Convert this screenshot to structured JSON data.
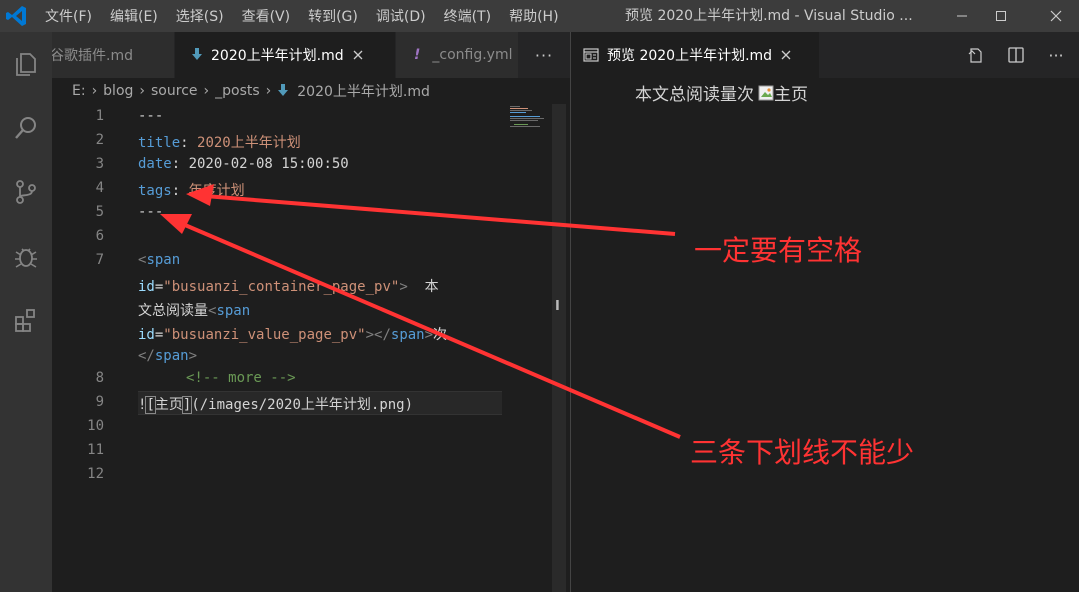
{
  "titlebar": {
    "menus": [
      "文件(F)",
      "编辑(E)",
      "选择(S)",
      "查看(V)",
      "转到(G)",
      "调试(D)",
      "终端(T)",
      "帮助(H)"
    ],
    "title": "预览 2020上半年计划.md - Visual Studio ...",
    "logo_icon": "vscode-logo-icon",
    "accent": "#0078d4"
  },
  "activity_bar": {
    "icons": [
      "files-icon",
      "search-icon",
      "source-control-icon",
      "debug-icon",
      "extensions-icon"
    ]
  },
  "left_tabs": [
    {
      "label": "谷歌插件.md",
      "icon": "markdown-icon",
      "active": false
    },
    {
      "label": "2020上半年计划.md",
      "icon": "markdown-icon",
      "active": true
    },
    {
      "label": "_config.yml",
      "icon": "yaml-icon",
      "active": false
    }
  ],
  "right_tab": {
    "label": "预览 2020上半年计划.md",
    "icon": "preview-icon"
  },
  "breadcrumb": [
    "E:",
    "blog",
    "source",
    "_posts",
    "2020上半年计划.md"
  ],
  "editor": {
    "line_numbers": [
      "1",
      "2",
      "3",
      "4",
      "5",
      "6",
      "7",
      "8",
      "9",
      "10",
      "11",
      "12"
    ],
    "lines": {
      "l1": "---",
      "l2_key": "title",
      "l2_val": "2020上半年计划",
      "l3_key": "date",
      "l3_val": "2020-02-08 15:00:50",
      "l4_key": "tags",
      "l4_val": "年度计划",
      "l5": "---",
      "l7a_tag": "span",
      "l7b_attr": "id",
      "l7b_val": "\"busuanzi_container_page_pv\"",
      "l7b_text": "  本",
      "l7c_text": "文总阅读量",
      "l7c_tag": "span",
      "l7d_attr": "id",
      "l7d_val": "\"busuanzi_value_page_pv\"",
      "l7d_close": "span",
      "l7d_text": "次",
      "l7e_tag": "span",
      "l8": "<!-- more -->",
      "l9_bang": "!",
      "l9_alt": "主页",
      "l9_url": "(/images/2020上半年计划.png)"
    }
  },
  "preview": {
    "text": "本文总阅读量次",
    "img_alt": "主页"
  },
  "annotations": {
    "note1": "一定要有空格",
    "note2": "三条下划线不能少",
    "color": "#ff3333"
  }
}
